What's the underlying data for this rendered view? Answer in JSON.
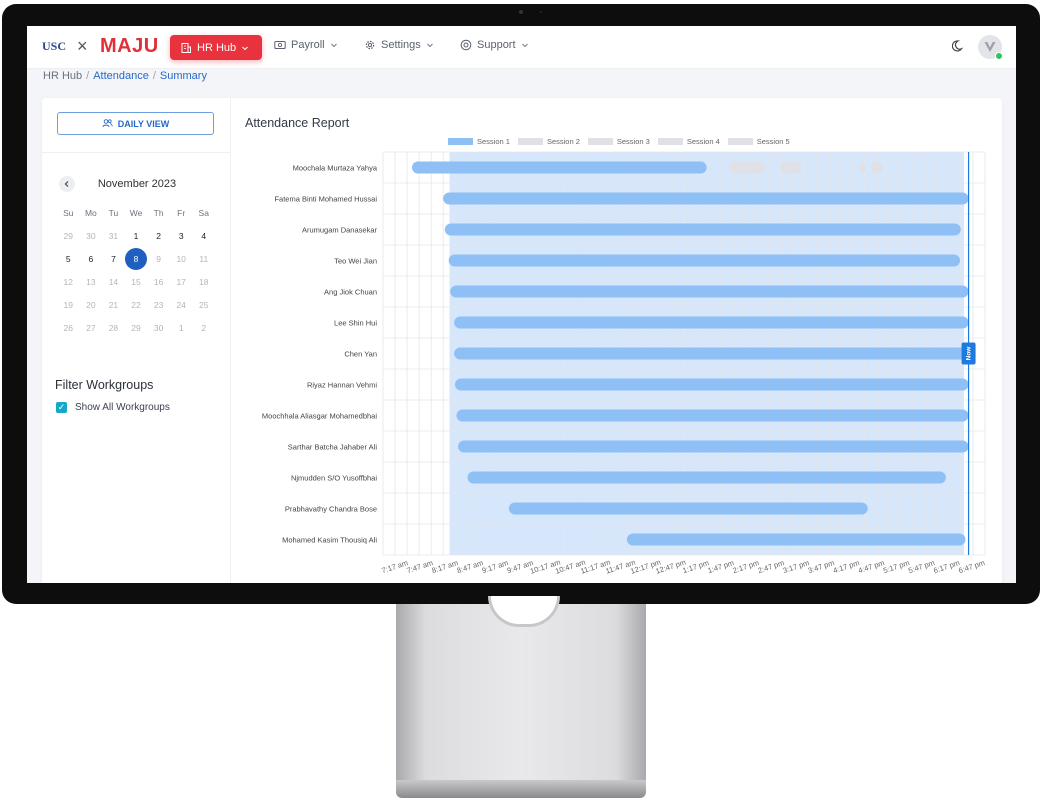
{
  "navbar": {
    "logo_usc": "USC",
    "logo_separator": "×",
    "logo_maju": "MAJU",
    "items": [
      {
        "label": "HR Hub",
        "icon": "building-icon",
        "active": true
      },
      {
        "label": "Payroll",
        "icon": "cash-icon"
      },
      {
        "label": "Settings",
        "icon": "gear-icon"
      },
      {
        "label": "Support",
        "icon": "lifebuoy-icon"
      }
    ],
    "theme_icon": "moon-icon",
    "avatar_icon": "v-logo-icon",
    "avatar_status_color": "#2ec266"
  },
  "breadcrumb": {
    "root": "HR Hub",
    "level1": "Attendance",
    "level2": "Summary"
  },
  "sidebar": {
    "daily_view_label": "DAILY VIEW",
    "calendar": {
      "month_label": "November 2023",
      "weekdays": [
        "Su",
        "Mo",
        "Tu",
        "We",
        "Th",
        "Fr",
        "Sa"
      ],
      "weeks": [
        [
          {
            "d": "29",
            "m": 0
          },
          {
            "d": "30",
            "m": 0
          },
          {
            "d": "31",
            "m": 0
          },
          {
            "d": "1",
            "m": 1
          },
          {
            "d": "2",
            "m": 1
          },
          {
            "d": "3",
            "m": 1
          },
          {
            "d": "4",
            "m": 1
          }
        ],
        [
          {
            "d": "5",
            "m": 1
          },
          {
            "d": "6",
            "m": 1
          },
          {
            "d": "7",
            "m": 1
          },
          {
            "d": "8",
            "m": 1,
            "s": 1
          },
          {
            "d": "9",
            "m": 0
          },
          {
            "d": "10",
            "m": 0
          },
          {
            "d": "11",
            "m": 0
          }
        ],
        [
          {
            "d": "12",
            "m": 0
          },
          {
            "d": "13",
            "m": 0
          },
          {
            "d": "14",
            "m": 0
          },
          {
            "d": "15",
            "m": 0
          },
          {
            "d": "16",
            "m": 0
          },
          {
            "d": "17",
            "m": 0
          },
          {
            "d": "18",
            "m": 0
          }
        ],
        [
          {
            "d": "19",
            "m": 0
          },
          {
            "d": "20",
            "m": 0
          },
          {
            "d": "21",
            "m": 0
          },
          {
            "d": "22",
            "m": 0
          },
          {
            "d": "23",
            "m": 0
          },
          {
            "d": "24",
            "m": 0
          },
          {
            "d": "25",
            "m": 0
          }
        ],
        [
          {
            "d": "26",
            "m": 0
          },
          {
            "d": "27",
            "m": 0
          },
          {
            "d": "28",
            "m": 0
          },
          {
            "d": "29",
            "m": 0
          },
          {
            "d": "30",
            "m": 0
          },
          {
            "d": "1",
            "m": 0
          },
          {
            "d": "2",
            "m": 0
          }
        ]
      ],
      "selected_color": "#1f5fbf"
    },
    "filter_title": "Filter Workgroups",
    "show_all_label": "Show All Workgroups",
    "show_all_checked": true
  },
  "report": {
    "title": "Attendance Report",
    "legend": [
      {
        "label": "Session 1",
        "color": "#8fc0f5"
      },
      {
        "label": "Session 2",
        "color": "#dfe1e6"
      },
      {
        "label": "Session 3",
        "color": "#dfe1e6"
      },
      {
        "label": "Session 4",
        "color": "#dfe1e6"
      },
      {
        "label": "Session 5",
        "color": "#dfe1e6"
      }
    ],
    "now_label": "Now"
  },
  "chart_data": {
    "type": "gantt",
    "x_unit": "minutes since midnight",
    "x_range": [
      437,
      1207
    ],
    "x_ticks": [
      "7:17 am",
      "7:47 am",
      "8:17 am",
      "8:47 am",
      "9:17 am",
      "9:47 am",
      "10:17 am",
      "10:47 am",
      "11:17 am",
      "11:47 am",
      "12:17 pm",
      "12:47 pm",
      "1:17 pm",
      "1:47 pm",
      "2:17 pm",
      "2:47 pm",
      "3:17 pm",
      "3:47 pm",
      "4:17 pm",
      "4:47 pm",
      "5:17 pm",
      "5:47 pm",
      "6:17 pm",
      "6:47 pm"
    ],
    "highlight_range": [
      522,
      1180
    ],
    "now": 1186,
    "bar_color": "#8fc0f5",
    "ghost_color": "#dfe1e6",
    "highlight_color": "#d6e6fb",
    "now_color": "#1f7ae0",
    "rows": [
      {
        "name": "Moochala Murtaza Yahya",
        "sessions": [
          [
            474,
            851
          ]
        ],
        "ghost": [
          [
            880,
            926
          ],
          [
            946,
            972
          ],
          [
            1046,
            1054
          ],
          [
            1062,
            1076
          ]
        ]
      },
      {
        "name": "Fatema Binti Mohamed Hussai",
        "sessions": [
          [
            514,
            1186
          ]
        ],
        "ghost": []
      },
      {
        "name": "Arumugam Danasekar",
        "sessions": [
          [
            516,
            1176
          ]
        ],
        "ghost": []
      },
      {
        "name": "Teo Wei Jian",
        "sessions": [
          [
            521,
            1175
          ]
        ],
        "ghost": []
      },
      {
        "name": "Ang Jiok Chuan",
        "sessions": [
          [
            523,
            1186
          ]
        ],
        "ghost": []
      },
      {
        "name": "Lee Shin Hui",
        "sessions": [
          [
            528,
            1186
          ]
        ],
        "ghost": []
      },
      {
        "name": "Chen Yan",
        "sessions": [
          [
            528,
            1186
          ]
        ],
        "ghost": []
      },
      {
        "name": "Riyaz Hannan Vehmi",
        "sessions": [
          [
            529,
            1186
          ]
        ],
        "ghost": []
      },
      {
        "name": "Moochhala Aliasgar Mohamedbhai",
        "sessions": [
          [
            531,
            1186
          ]
        ],
        "ghost": []
      },
      {
        "name": "Sarthar Batcha Jahaber Ali",
        "sessions": [
          [
            533,
            1186
          ]
        ],
        "ghost": []
      },
      {
        "name": "Njmudden S/O Yusoffbhai",
        "sessions": [
          [
            545,
            1157
          ]
        ],
        "ghost": []
      },
      {
        "name": "Prabhavathy Chandra Bose",
        "sessions": [
          [
            598,
            1057
          ]
        ],
        "ghost": []
      },
      {
        "name": "Mohamed Kasim Thousiq Ali",
        "sessions": [
          [
            749,
            1182
          ]
        ],
        "ghost": []
      }
    ]
  }
}
